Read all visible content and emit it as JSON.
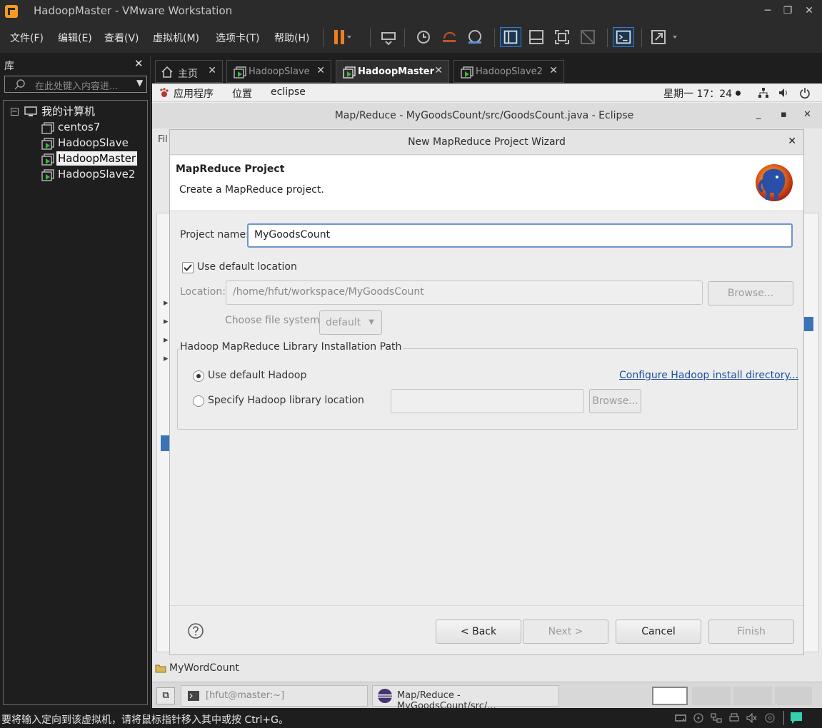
{
  "vm_window": {
    "title": "HadoopMaster - VMware Workstation",
    "menus": [
      "文件(F)",
      "编辑(E)",
      "查看(V)",
      "虚拟机(M)",
      "选项卡(T)",
      "帮助(H)"
    ]
  },
  "library": {
    "title": "库",
    "search_placeholder": "在此处键入内容进...",
    "root": "我的计算机",
    "items": [
      "centos7",
      "HadoopSlave",
      "HadoopMaster",
      "HadoopSlave2"
    ],
    "selected": "HadoopMaster"
  },
  "vm_tabs": [
    {
      "label": "主页"
    },
    {
      "label": "HadoopSlave"
    },
    {
      "label": "HadoopMaster",
      "active": true
    },
    {
      "label": "HadoopSlave2"
    }
  ],
  "gnome_top": {
    "apps": "应用程序",
    "places": "位置",
    "app": "eclipse",
    "clock": "星期一 17：24"
  },
  "eclipse": {
    "title": "Map/Reduce - MyGoodsCount/src/GoodsCount.java - Eclipse",
    "status_project": "MyWordCount"
  },
  "dialog": {
    "title": "New MapReduce Project Wizard",
    "banner_title": "MapReduce Project",
    "banner_desc": "Create a MapReduce project.",
    "project_name_label": "Project name:",
    "project_name_value": "MyGoodsCount",
    "use_default_location": "Use default location",
    "use_default_location_checked": true,
    "location_label": "Location:",
    "location_value": "/home/hfut/workspace/MyGoodsCount",
    "browse_label": "Browse...",
    "file_system_label": "Choose file system:",
    "file_system_value": "default",
    "group_title": "Hadoop MapReduce Library Installation Path",
    "use_default_hadoop": "Use default Hadoop",
    "configure_link": "Configure Hadoop install directory...",
    "specify_hadoop": "Specify Hadoop library location",
    "browse2_label": "Browse...",
    "back_label": "< Back",
    "next_label": "Next >",
    "cancel_label": "Cancel",
    "finish_label": "Finish"
  },
  "taskbar": {
    "terminal": "[hfut@master:~]",
    "eclipse": "Map/Reduce - MyGoodsCount/src/..."
  },
  "host_status": "要将输入定向到该虚拟机，请将鼠标指针移入其中或按 Ctrl+G。"
}
